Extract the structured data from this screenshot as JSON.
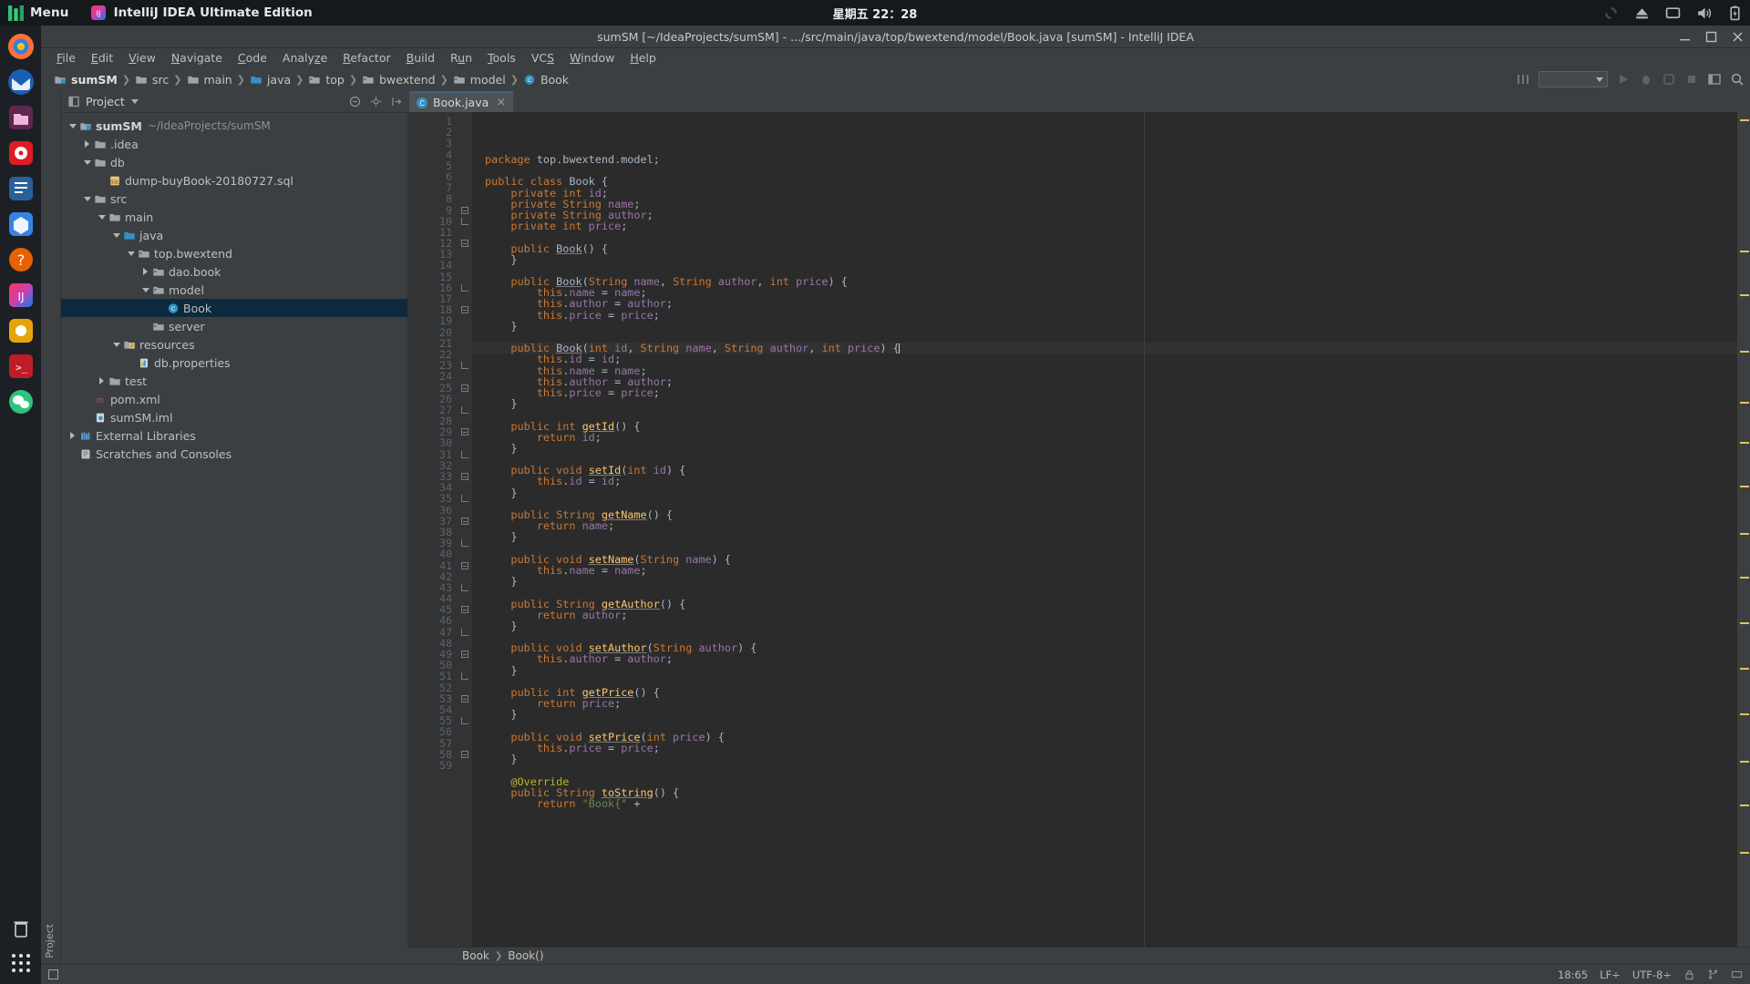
{
  "os": {
    "menu_label": "Menu",
    "app_name": "IntelliJ IDEA Ultimate Edition",
    "clock": "星期五 22：28",
    "tray": [
      "sync-icon",
      "eject-icon",
      "display-icon",
      "volume-icon",
      "battery-icon"
    ]
  },
  "dock": {
    "items": [
      "firefox-icon",
      "thunderbird-icon",
      "files-icon",
      "rhythmbox-icon",
      "libreoffice-writer-icon",
      "ubuntu-software-icon",
      "help-icon",
      "intellij-idea-icon",
      "photos-icon",
      "terminal-icon",
      "wechat-icon"
    ],
    "apps_label": "show-applications-icon",
    "trash_label": "trash-icon"
  },
  "window": {
    "title": "sumSM [~/IdeaProjects/sumSM] - .../src/main/java/top/bwextend/model/Book.java [sumSM] - IntelliJ IDEA",
    "minimize": "minimize-icon",
    "maximize": "maximize-icon",
    "close": "close-icon"
  },
  "menubar": [
    {
      "label": "File",
      "mnemonic": "F"
    },
    {
      "label": "Edit",
      "mnemonic": "E"
    },
    {
      "label": "View",
      "mnemonic": "V"
    },
    {
      "label": "Navigate",
      "mnemonic": "N"
    },
    {
      "label": "Code",
      "mnemonic": "C"
    },
    {
      "label": "Analyze",
      "mnemonic": "z"
    },
    {
      "label": "Refactor",
      "mnemonic": "R"
    },
    {
      "label": "Build",
      "mnemonic": "B"
    },
    {
      "label": "Run",
      "mnemonic": "u"
    },
    {
      "label": "Tools",
      "mnemonic": "T"
    },
    {
      "label": "VCS",
      "mnemonic": "S"
    },
    {
      "label": "Window",
      "mnemonic": "W"
    },
    {
      "label": "Help",
      "mnemonic": "H"
    }
  ],
  "navbar": {
    "crumbs": [
      {
        "label": "sumSM",
        "icon": "module-icon",
        "bold": true
      },
      {
        "label": "src",
        "icon": "folder-icon",
        "bold": false
      },
      {
        "label": "main",
        "icon": "folder-icon",
        "bold": false
      },
      {
        "label": "java",
        "icon": "source-folder-icon",
        "bold": false
      },
      {
        "label": "top",
        "icon": "package-icon",
        "bold": false
      },
      {
        "label": "bwextend",
        "icon": "package-icon",
        "bold": false
      },
      {
        "label": "model",
        "icon": "package-icon",
        "bold": false
      },
      {
        "label": "Book",
        "icon": "class-icon",
        "bold": false
      }
    ],
    "run_config_placeholder": "",
    "icons": [
      "vcs-update-icon",
      "run-icon",
      "debug-icon",
      "coverage-icon",
      "stop-icon",
      "layout-icon",
      "search-icon"
    ]
  },
  "project_panel": {
    "header_title": "Project",
    "header_icons": [
      "collapse-all-icon",
      "settings-icon",
      "hide-icon"
    ],
    "tree": [
      {
        "depth": 0,
        "arrow": "down",
        "icon": "module-icon",
        "label": "sumSM",
        "bold": true,
        "sub": "~/IdeaProjects/sumSM",
        "selected": false
      },
      {
        "depth": 1,
        "arrow": "right",
        "icon": "folder-icon",
        "label": ".idea",
        "bold": false,
        "sub": "",
        "selected": false
      },
      {
        "depth": 1,
        "arrow": "down",
        "icon": "folder-icon",
        "label": "db",
        "bold": false,
        "sub": "",
        "selected": false
      },
      {
        "depth": 2,
        "arrow": "none",
        "icon": "sql-file-icon",
        "label": "dump-buyBook-20180727.sql",
        "bold": false,
        "sub": "",
        "selected": false
      },
      {
        "depth": 1,
        "arrow": "down",
        "icon": "folder-icon",
        "label": "src",
        "bold": false,
        "sub": "",
        "selected": false
      },
      {
        "depth": 2,
        "arrow": "down",
        "icon": "folder-icon",
        "label": "main",
        "bold": false,
        "sub": "",
        "selected": false
      },
      {
        "depth": 3,
        "arrow": "down",
        "icon": "source-folder-icon",
        "label": "java",
        "bold": false,
        "sub": "",
        "selected": false
      },
      {
        "depth": 4,
        "arrow": "down",
        "icon": "package-icon",
        "label": "top.bwextend",
        "bold": false,
        "sub": "",
        "selected": false
      },
      {
        "depth": 5,
        "arrow": "right",
        "icon": "package-icon",
        "label": "dao.book",
        "bold": false,
        "sub": "",
        "selected": false
      },
      {
        "depth": 5,
        "arrow": "down",
        "icon": "package-icon",
        "label": "model",
        "bold": false,
        "sub": "",
        "selected": false
      },
      {
        "depth": 6,
        "arrow": "none",
        "icon": "class-icon",
        "label": "Book",
        "bold": false,
        "sub": "",
        "selected": true
      },
      {
        "depth": 5,
        "arrow": "none",
        "icon": "package-icon",
        "label": "server",
        "bold": false,
        "sub": "",
        "selected": false
      },
      {
        "depth": 3,
        "arrow": "down",
        "icon": "resources-folder-icon",
        "label": "resources",
        "bold": false,
        "sub": "",
        "selected": false
      },
      {
        "depth": 4,
        "arrow": "none",
        "icon": "properties-file-icon",
        "label": "db.properties",
        "bold": false,
        "sub": "",
        "selected": false
      },
      {
        "depth": 2,
        "arrow": "right",
        "icon": "folder-icon",
        "label": "test",
        "bold": false,
        "sub": "",
        "selected": false
      },
      {
        "depth": 1,
        "arrow": "none",
        "icon": "maven-icon",
        "label": "pom.xml",
        "bold": false,
        "sub": "",
        "selected": false
      },
      {
        "depth": 1,
        "arrow": "none",
        "icon": "iml-file-icon",
        "label": "sumSM.iml",
        "bold": false,
        "sub": "",
        "selected": false
      },
      {
        "depth": 0,
        "arrow": "right",
        "icon": "libraries-icon",
        "label": "External Libraries",
        "bold": false,
        "sub": "",
        "selected": false
      },
      {
        "depth": 0,
        "arrow": "none",
        "icon": "scratches-icon",
        "label": "Scratches and Consoles",
        "bold": false,
        "sub": "",
        "selected": false
      }
    ]
  },
  "left_strip": {
    "label": "Project"
  },
  "editor": {
    "tab": {
      "label": "Book.java",
      "icon": "java-class-icon",
      "close": "×"
    },
    "first_line": 1,
    "lines": [
      {
        "n": 1,
        "fold": "",
        "text": "package top.bwextend.model;"
      },
      {
        "n": 2,
        "fold": "",
        "text": ""
      },
      {
        "n": 3,
        "fold": "",
        "text": "public class Book {"
      },
      {
        "n": 4,
        "fold": "",
        "text": "    private int id;"
      },
      {
        "n": 5,
        "fold": "",
        "text": "    private String name;"
      },
      {
        "n": 6,
        "fold": "",
        "text": "    private String author;"
      },
      {
        "n": 7,
        "fold": "",
        "text": "    private int price;"
      },
      {
        "n": 8,
        "fold": "",
        "text": ""
      },
      {
        "n": 9,
        "fold": "open",
        "text": "    public Book() {"
      },
      {
        "n": 10,
        "fold": "end",
        "text": "    }"
      },
      {
        "n": 11,
        "fold": "",
        "text": ""
      },
      {
        "n": 12,
        "fold": "open",
        "text": "    public Book(String name, String author, int price) {"
      },
      {
        "n": 13,
        "fold": "",
        "text": "        this.name = name;"
      },
      {
        "n": 14,
        "fold": "",
        "text": "        this.author = author;"
      },
      {
        "n": 15,
        "fold": "",
        "text": "        this.price = price;"
      },
      {
        "n": 16,
        "fold": "end",
        "text": "    }"
      },
      {
        "n": 17,
        "fold": "",
        "text": ""
      },
      {
        "n": 18,
        "fold": "open",
        "text": "    public Book(int id, String name, String author, int price) {"
      },
      {
        "n": 19,
        "fold": "",
        "text": "        this.id = id;"
      },
      {
        "n": 20,
        "fold": "",
        "text": "        this.name = name;"
      },
      {
        "n": 21,
        "fold": "",
        "text": "        this.author = author;"
      },
      {
        "n": 22,
        "fold": "",
        "text": "        this.price = price;"
      },
      {
        "n": 23,
        "fold": "end",
        "text": "    }"
      },
      {
        "n": 24,
        "fold": "",
        "text": ""
      },
      {
        "n": 25,
        "fold": "open",
        "text": "    public int getId() {"
      },
      {
        "n": 26,
        "fold": "",
        "text": "        return id;"
      },
      {
        "n": 27,
        "fold": "end",
        "text": "    }"
      },
      {
        "n": 28,
        "fold": "",
        "text": ""
      },
      {
        "n": 29,
        "fold": "open",
        "text": "    public void setId(int id) {"
      },
      {
        "n": 30,
        "fold": "",
        "text": "        this.id = id;"
      },
      {
        "n": 31,
        "fold": "end",
        "text": "    }"
      },
      {
        "n": 32,
        "fold": "",
        "text": ""
      },
      {
        "n": 33,
        "fold": "open",
        "text": "    public String getName() {"
      },
      {
        "n": 34,
        "fold": "",
        "text": "        return name;"
      },
      {
        "n": 35,
        "fold": "end",
        "text": "    }"
      },
      {
        "n": 36,
        "fold": "",
        "text": ""
      },
      {
        "n": 37,
        "fold": "open",
        "text": "    public void setName(String name) {"
      },
      {
        "n": 38,
        "fold": "",
        "text": "        this.name = name;"
      },
      {
        "n": 39,
        "fold": "end",
        "text": "    }"
      },
      {
        "n": 40,
        "fold": "",
        "text": ""
      },
      {
        "n": 41,
        "fold": "open",
        "text": "    public String getAuthor() {"
      },
      {
        "n": 42,
        "fold": "",
        "text": "        return author;"
      },
      {
        "n": 43,
        "fold": "end",
        "text": "    }"
      },
      {
        "n": 44,
        "fold": "",
        "text": ""
      },
      {
        "n": 45,
        "fold": "open",
        "text": "    public void setAuthor(String author) {"
      },
      {
        "n": 46,
        "fold": "",
        "text": "        this.author = author;"
      },
      {
        "n": 47,
        "fold": "end",
        "text": "    }"
      },
      {
        "n": 48,
        "fold": "",
        "text": ""
      },
      {
        "n": 49,
        "fold": "open",
        "text": "    public int getPrice() {"
      },
      {
        "n": 50,
        "fold": "",
        "text": "        return price;"
      },
      {
        "n": 51,
        "fold": "end",
        "text": "    }"
      },
      {
        "n": 52,
        "fold": "",
        "text": ""
      },
      {
        "n": 53,
        "fold": "open",
        "text": "    public void setPrice(int price) {"
      },
      {
        "n": 54,
        "fold": "",
        "text": "        this.price = price;"
      },
      {
        "n": 55,
        "fold": "end",
        "text": "    }"
      },
      {
        "n": 56,
        "fold": "",
        "text": ""
      },
      {
        "n": 57,
        "fold": "",
        "text": "    @Override"
      },
      {
        "n": 58,
        "fold": "open",
        "text": "    public String toString() {"
      },
      {
        "n": 59,
        "fold": "",
        "text": "        return \"Book{\" +"
      }
    ],
    "highlighted_line": 18,
    "breadcrumb": [
      "Book",
      "Book()"
    ]
  },
  "statusbar": {
    "caret": "18:65",
    "line_separator": "LF÷",
    "encoding": "UTF-8÷",
    "icons": [
      "lock-icon",
      "git-branch-icon",
      "memory-icon"
    ]
  }
}
